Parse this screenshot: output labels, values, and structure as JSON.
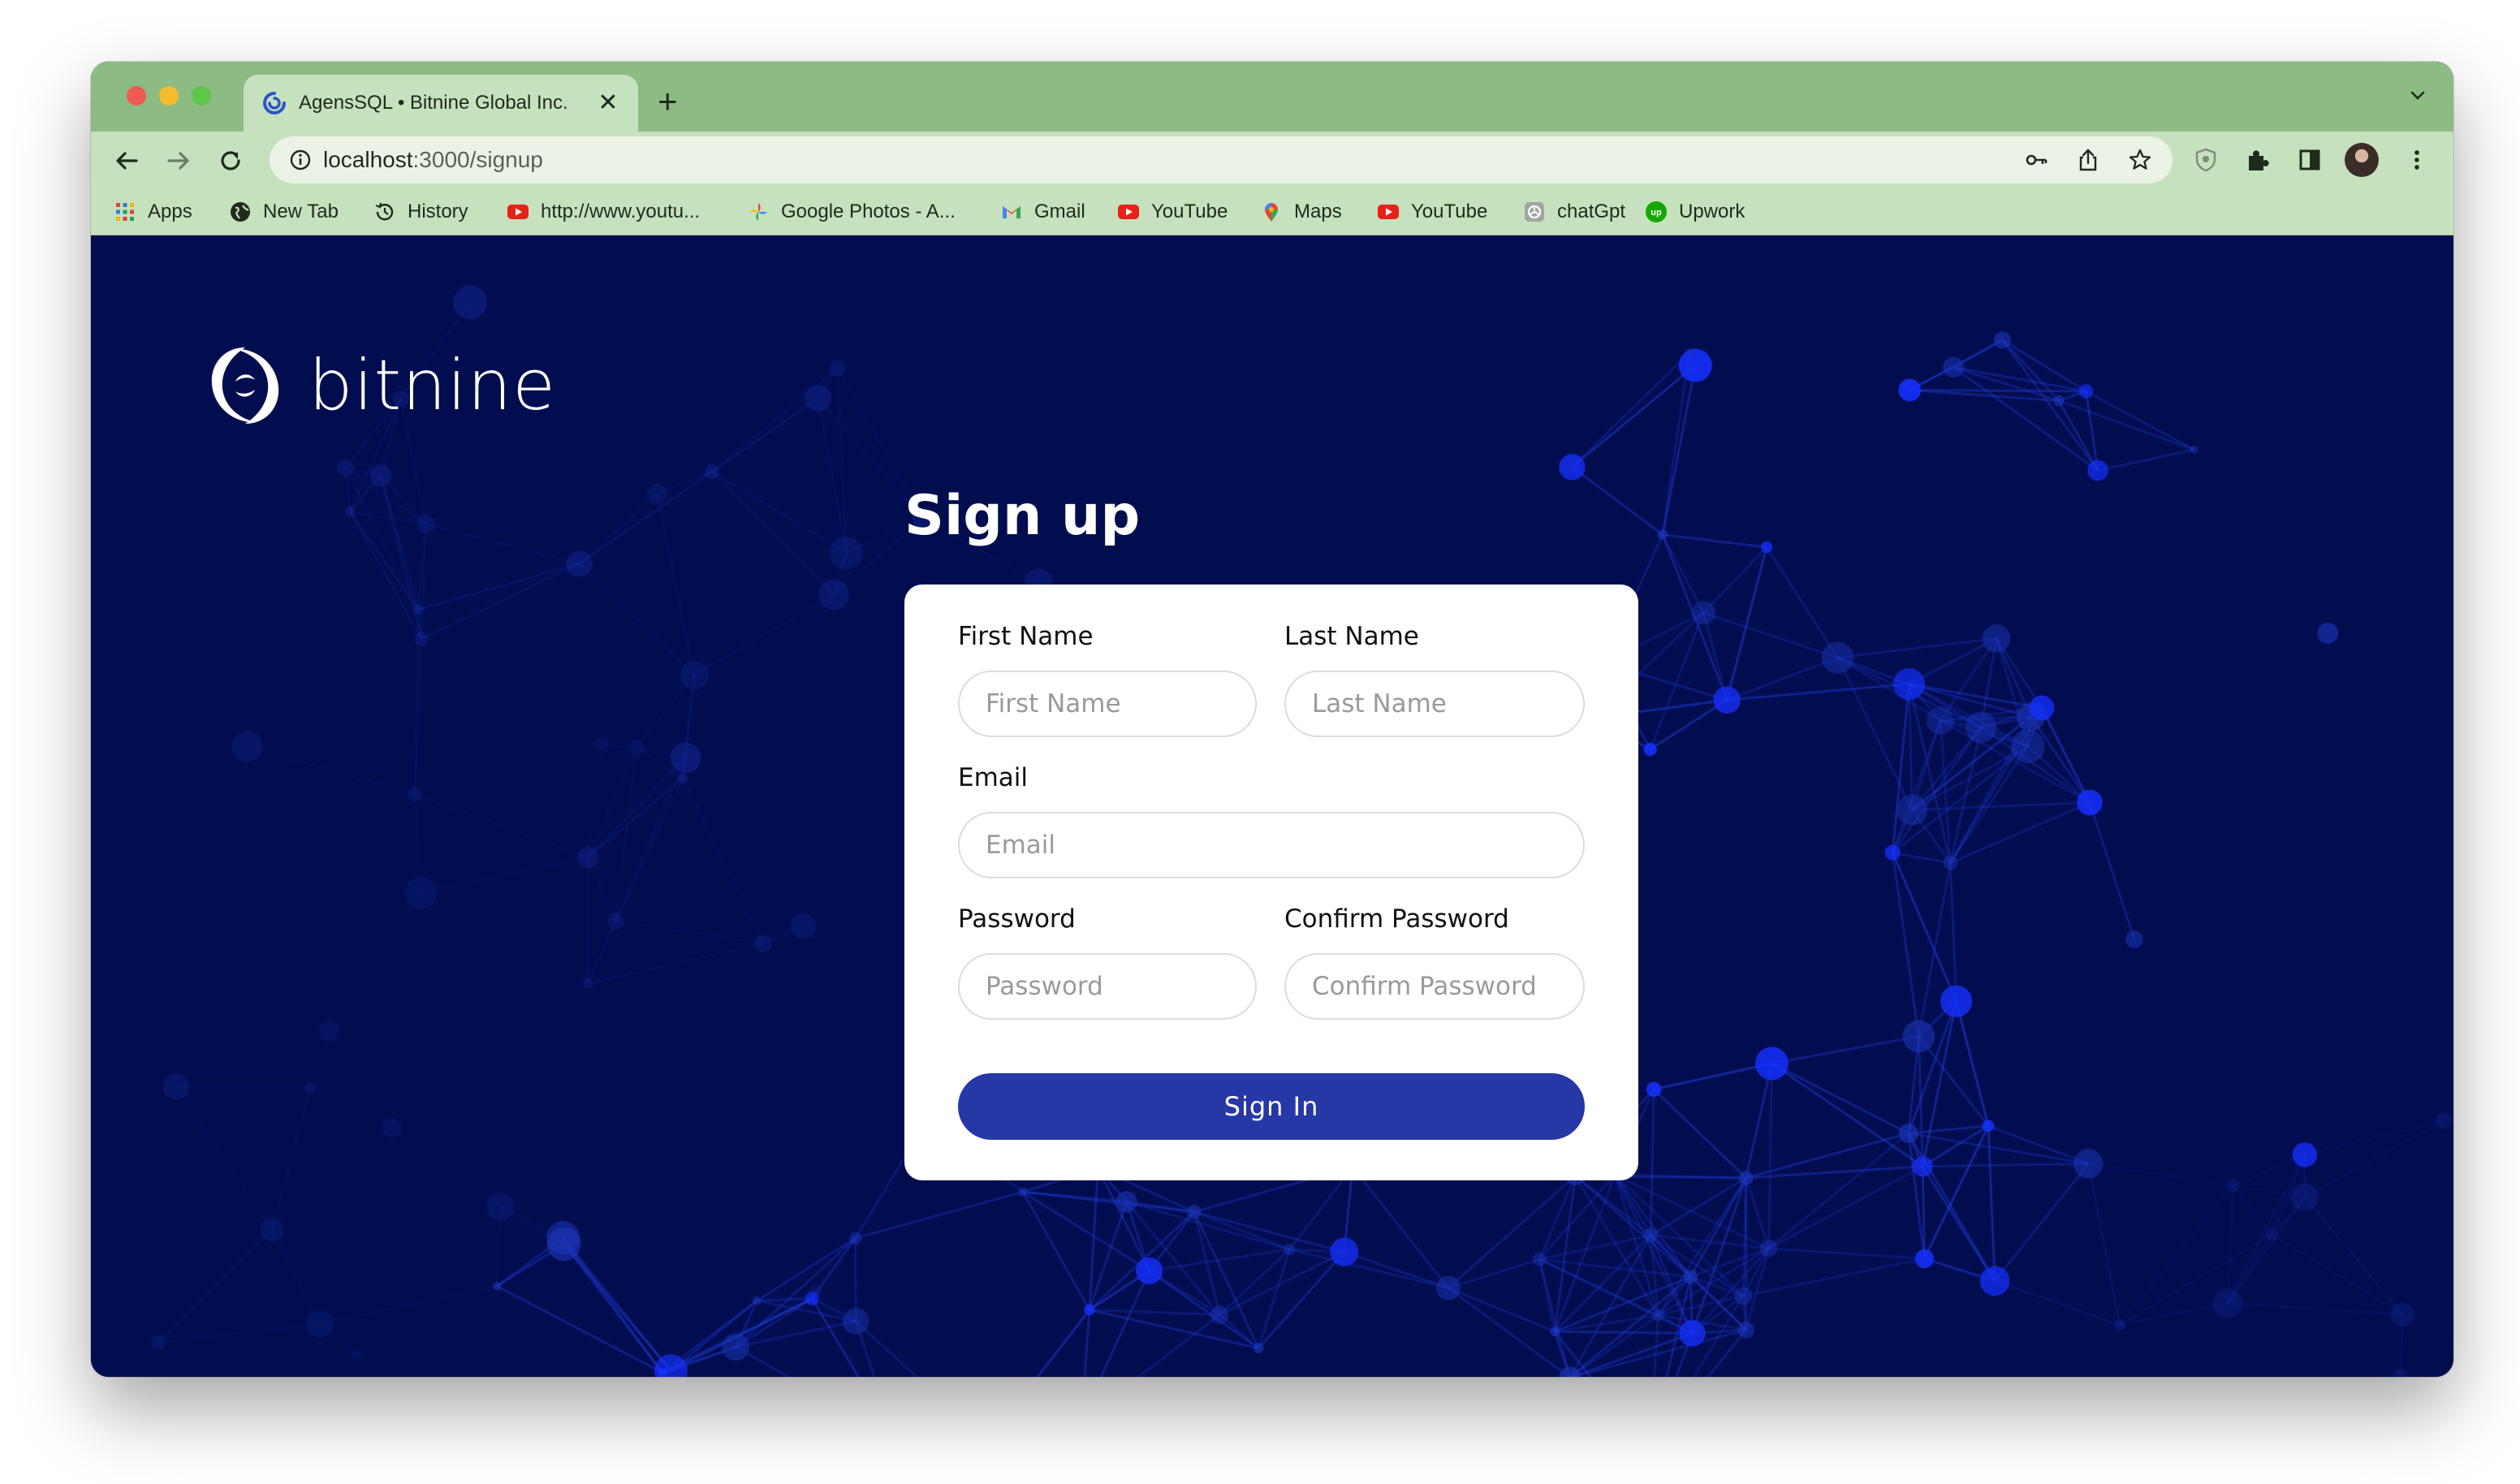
{
  "browser": {
    "tab": {
      "title": "AgensSQL • Bitnine Global Inc.",
      "close_label": "✕",
      "favicon": "bitnine-swirl-icon"
    },
    "new_tab_label": "+",
    "address": {
      "host": "localhost",
      "path": ":3000/signup"
    },
    "accent_color": "#8cbb83",
    "toolbar_color": "#c6e1bd",
    "bookmarks": [
      {
        "label": "Apps",
        "icon": "apps-grid-icon"
      },
      {
        "label": "New Tab",
        "icon": "globe-icon"
      },
      {
        "label": "History",
        "icon": "history-icon"
      },
      {
        "label": "http://www.youtu...",
        "icon": "youtube-icon"
      },
      {
        "label": "Google Photos - A...",
        "icon": "photos-pinwheel-icon"
      },
      {
        "label": "Gmail",
        "icon": "gmail-icon"
      },
      {
        "label": "YouTube",
        "icon": "youtube-icon"
      },
      {
        "label": "Maps",
        "icon": "maps-pin-icon"
      },
      {
        "label": "YouTube",
        "icon": "youtube-icon"
      },
      {
        "label": "chatGpt",
        "icon": "chatgpt-icon"
      },
      {
        "label": "Upwork",
        "icon": "upwork-icon"
      }
    ]
  },
  "page": {
    "background_color": "#020d4f",
    "brand": {
      "name": "bitnine"
    },
    "title": "Sign up",
    "form": {
      "first_name": {
        "label": "First Name",
        "placeholder": "First Name"
      },
      "last_name": {
        "label": "Last Name",
        "placeholder": "Last Name"
      },
      "email": {
        "label": "Email",
        "placeholder": "Email"
      },
      "password": {
        "label": "Password",
        "placeholder": "Password"
      },
      "confirm_password": {
        "label": "Confirm Password",
        "placeholder": "Confirm Password"
      },
      "submit_label": "Sign In",
      "submit_color": "#2538a6"
    }
  }
}
